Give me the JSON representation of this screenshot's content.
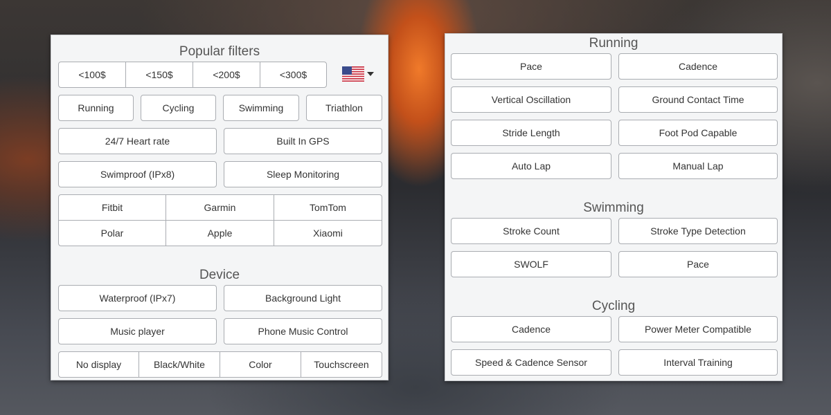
{
  "left": {
    "title": "Popular filters",
    "price_filters": [
      "<100$",
      "<150$",
      "<200$",
      "<300$"
    ],
    "country_flag": "us-flag-icon",
    "sports": [
      "Running",
      "Cycling",
      "Swimming",
      "Triathlon"
    ],
    "features": [
      "24/7 Heart rate",
      "Built In GPS",
      "Swimproof (IPx8)",
      "Sleep Monitoring"
    ],
    "brands": [
      "Fitbit",
      "Garmin",
      "TomTom",
      "Polar",
      "Apple",
      "Xiaomi"
    ],
    "device_title": "Device",
    "device_features": [
      "Waterproof (IPx7)",
      "Background Light",
      "Music player",
      "Phone Music Control"
    ],
    "display_types": [
      "No display",
      "Black/White",
      "Color",
      "Touchscreen"
    ]
  },
  "right": {
    "running_title": "Running",
    "running": [
      "Pace",
      "Cadence",
      "Vertical Oscillation",
      "Ground Contact Time",
      "Stride Length",
      "Foot Pod Capable",
      "Auto Lap",
      "Manual Lap"
    ],
    "swimming_title": "Swimming",
    "swimming": [
      "Stroke Count",
      "Stroke Type Detection",
      "SWOLF",
      "Pace"
    ],
    "cycling_title": "Cycling",
    "cycling": [
      "Cadence",
      "Power Meter Compatible",
      "Speed & Cadence Sensor",
      "Interval Training"
    ]
  }
}
